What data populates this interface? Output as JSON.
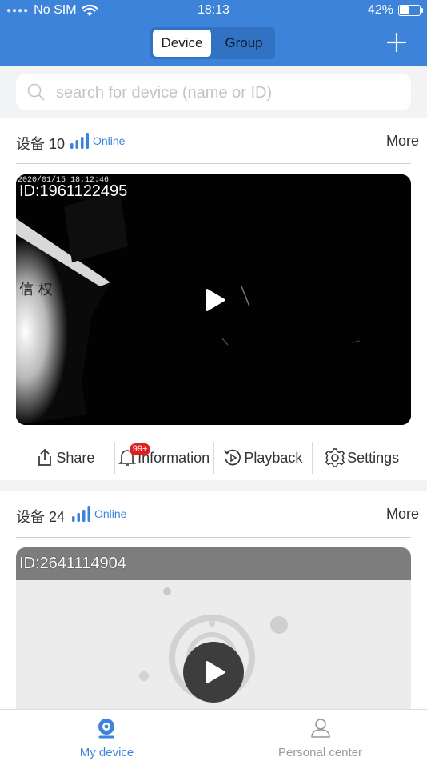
{
  "status_bar": {
    "carrier": "No SIM",
    "time": "18:13",
    "battery": "42%",
    "battery_level": 0.42
  },
  "header": {
    "tabs": [
      {
        "label": "Device",
        "active": true
      },
      {
        "label": "Group",
        "active": false
      }
    ],
    "add_icon": "plus-icon"
  },
  "search": {
    "placeholder": "search for device (name or ID)",
    "value": ""
  },
  "devices": [
    {
      "name": "设备 10",
      "status": "Online",
      "more_label": "More",
      "video_id": "ID:1961122495",
      "timestamp": "2020/01/15 18:12:46",
      "actions": [
        {
          "label": "Share",
          "icon": "share-icon"
        },
        {
          "label": "Information",
          "icon": "bell-icon",
          "badge": "99+"
        },
        {
          "label": "Playback",
          "icon": "playback-icon"
        },
        {
          "label": "Settings",
          "icon": "gear-icon"
        }
      ]
    },
    {
      "name": "设备 24",
      "status": "Online",
      "more_label": "More",
      "video_id": "ID:2641114904"
    }
  ],
  "tabbar": {
    "items": [
      {
        "label": "My device",
        "active": true,
        "icon": "camera-icon"
      },
      {
        "label": "Personal center",
        "active": false,
        "icon": "person-icon"
      }
    ]
  },
  "colors": {
    "accent": "#3d83d9",
    "badge": "#e02020",
    "inactive_text": "#999999"
  }
}
